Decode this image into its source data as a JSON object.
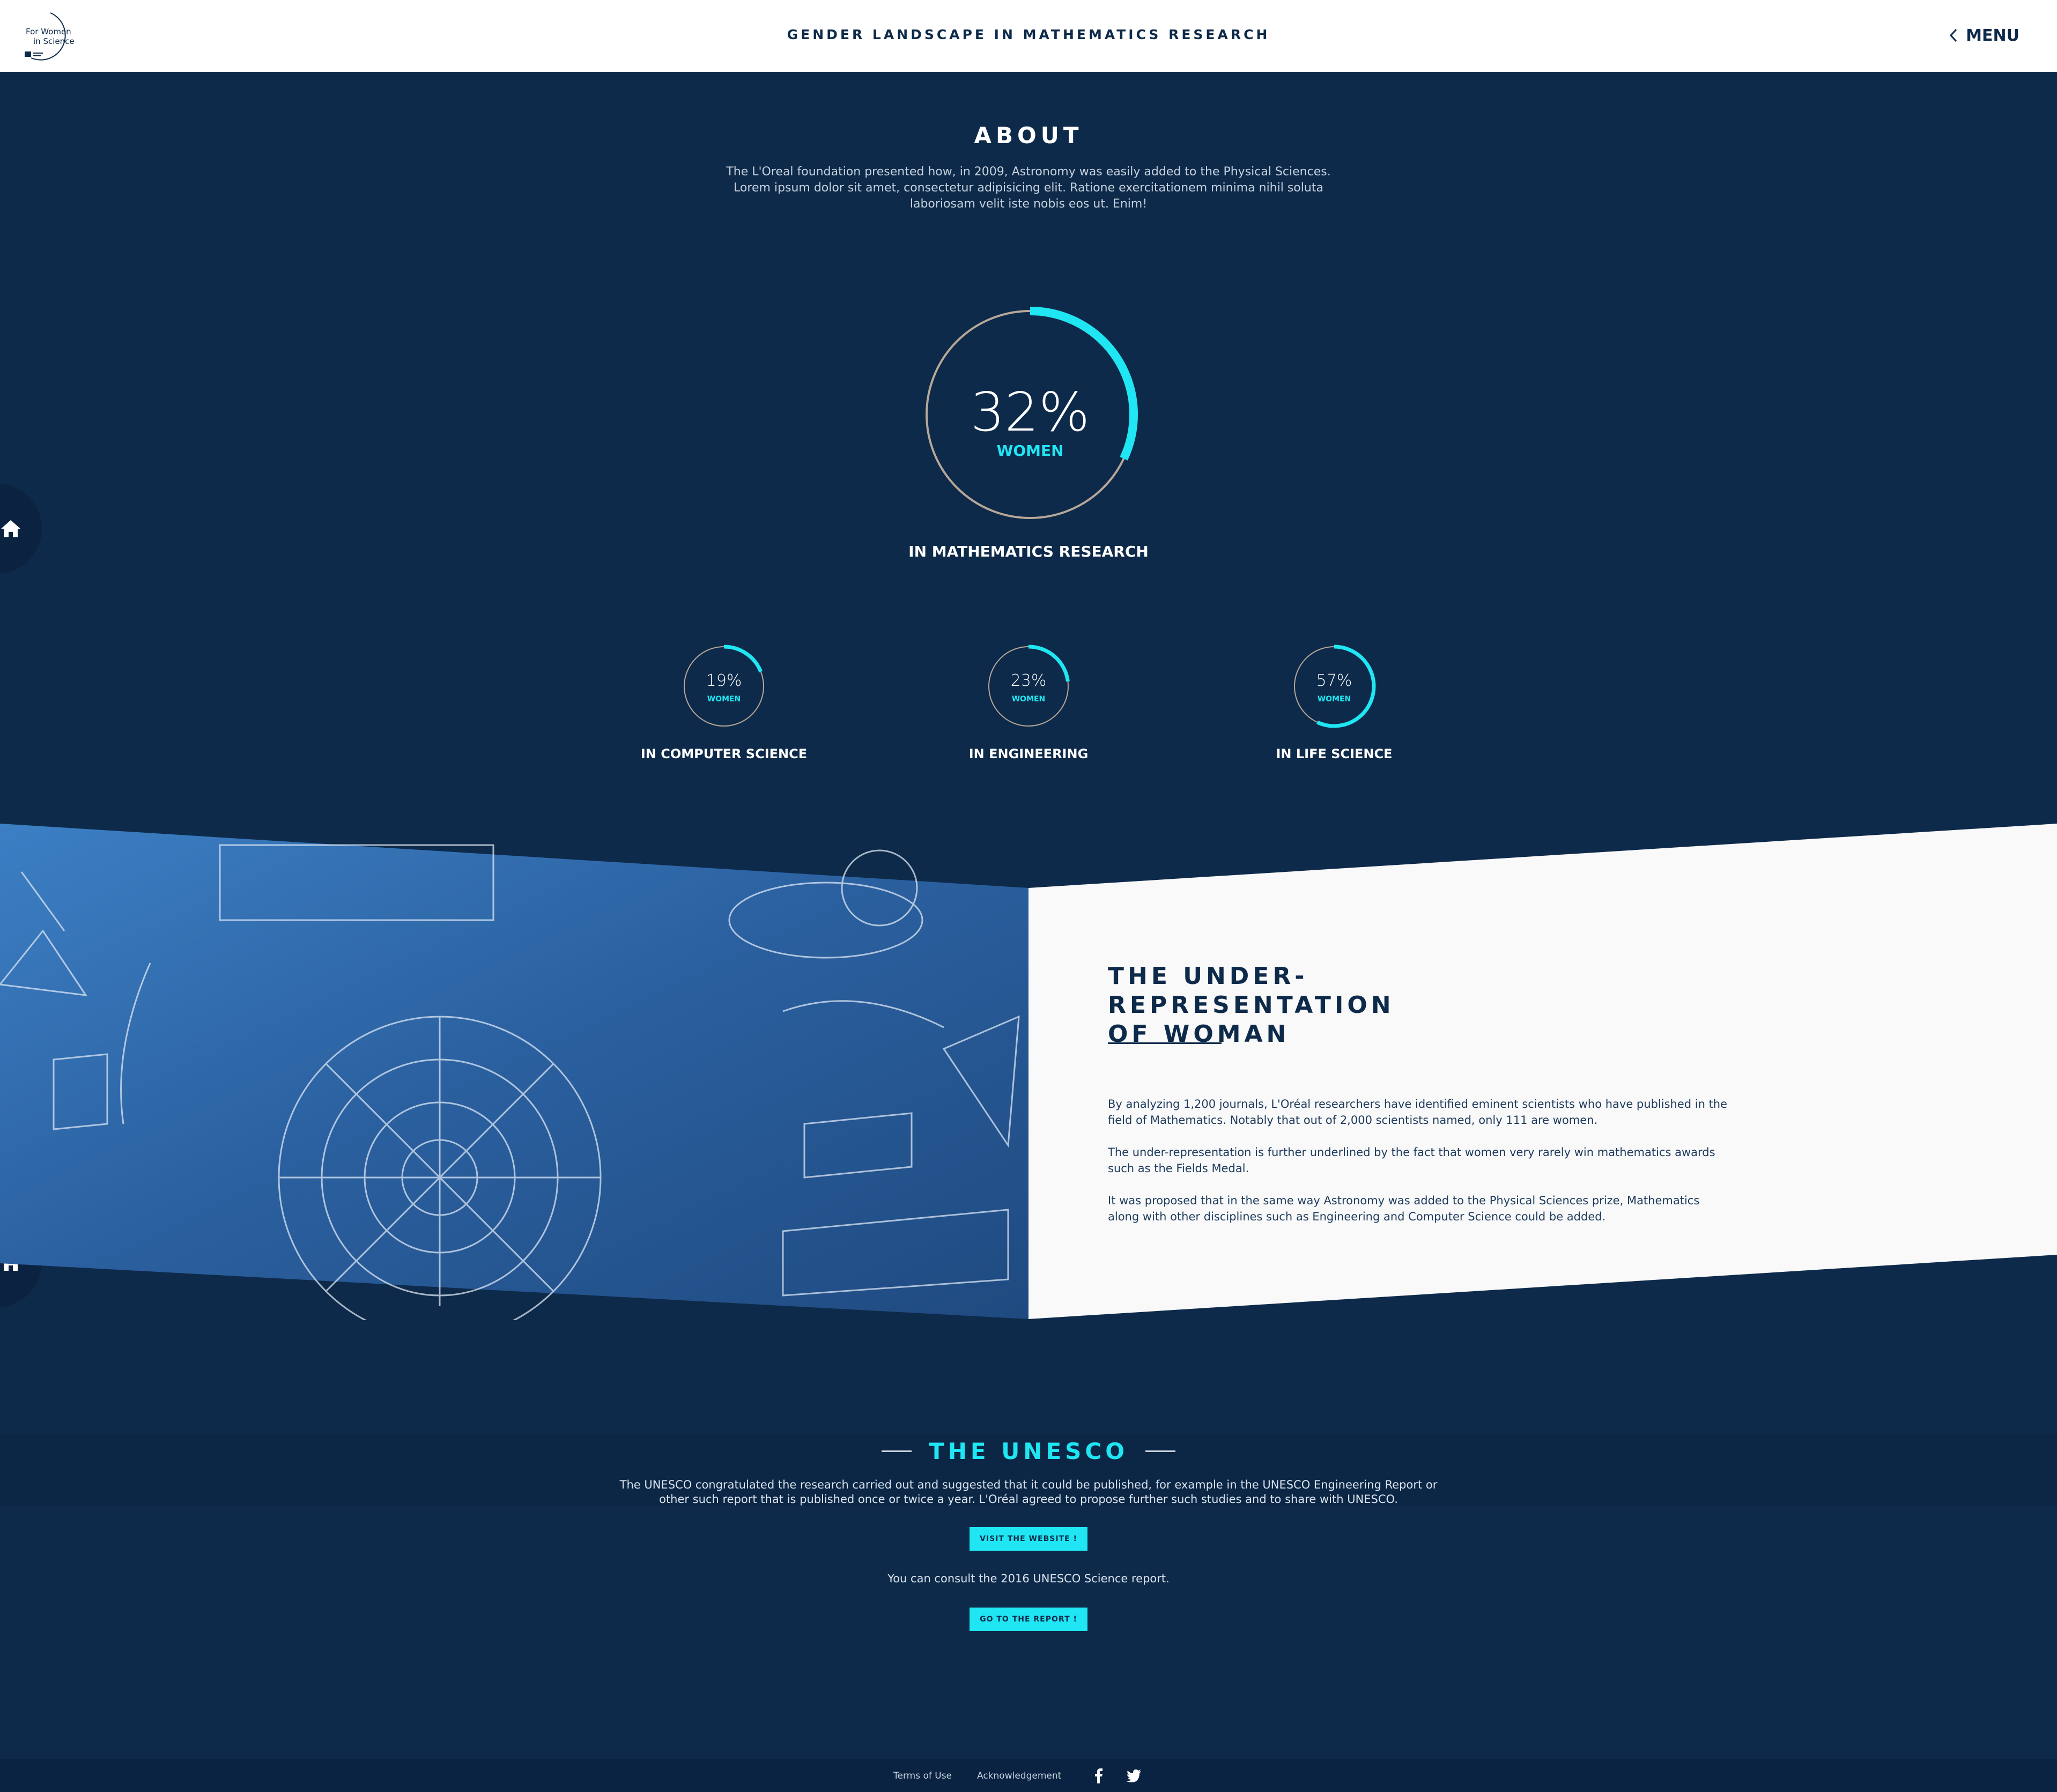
{
  "header": {
    "logo_text_line1": "For Women",
    "logo_text_line2": "in Science",
    "title": "GENDER LANDSCAPE IN MATHEMATICS RESEARCH",
    "menu_label": "MENU"
  },
  "about": {
    "title": "ABOUT",
    "text": "The L'Oreal foundation presented how, in 2009, Astronomy was easily added to the Physical Sciences. Lorem ipsum dolor sit amet, consectetur adipisicing elit. Ratione exercitationem minima nihil soluta laboriosam velit iste nobis eos ut. Enim!"
  },
  "main_stat": {
    "value": "32%",
    "fraction": 0.32,
    "unit": "WOMEN",
    "caption": "IN MATHEMATICS RESEARCH"
  },
  "stats": [
    {
      "value": "19%",
      "fraction": 0.19,
      "unit": "WOMEN",
      "caption": "IN COMPUTER SCIENCE"
    },
    {
      "value": "23%",
      "fraction": 0.23,
      "unit": "WOMEN",
      "caption": "IN ENGINEERING"
    },
    {
      "value": "57%",
      "fraction": 0.57,
      "unit": "WOMEN",
      "caption": "IN LIFE SCIENCE"
    }
  ],
  "under_representation": {
    "title_line1": "THE UNDER-REPRESENTATION",
    "title_line2": "OF WOMAN",
    "paragraphs": [
      "By analyzing 1,200 journals, L'Oréal researchers have identified eminent scientists who have published in the field of Mathematics. Notably that out of 2,000 scientists named, only 111 are women.",
      "The under-representation is further underlined by the fact that women very rarely win mathematics awards such as the Fields Medal.",
      "It was proposed that in the same way Astronomy was added to the Physical Sciences prize, Mathematics along with other disciplines such as Engineering and Computer Science could be added."
    ]
  },
  "unesco": {
    "title": "THE UNESCO",
    "text": "The UNESCO congratulated the research carried out and suggested that it could be published, for example in the UNESCO Engineering Report or other such report that is published once or twice a year. L'Oréal agreed to propose further such studies and to share with UNESCO.",
    "visit_button": "VISIT THE WEBSITE !",
    "consult_text": "You can consult the 2016 UNESCO Science report.",
    "report_button": "GO TO THE REPORT !"
  },
  "footer": {
    "terms": "Terms of Use",
    "acknowledgement": "Acknowledgement"
  },
  "icons": [
    "home-icon",
    "facebook-icon",
    "twitter-icon",
    "chevron-left-icon"
  ],
  "colors": {
    "navy": "#0e2a4a",
    "accent": "#1fe6f2",
    "ring_track": "#b7a898",
    "white": "#ffffff"
  }
}
